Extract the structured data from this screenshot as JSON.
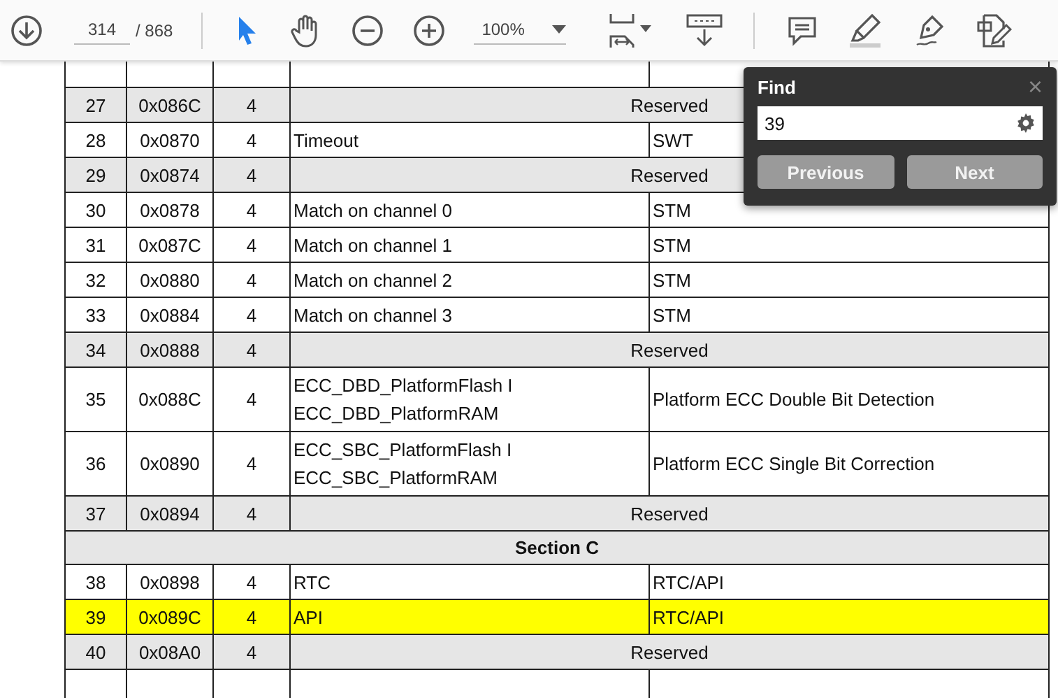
{
  "toolbar": {
    "page_number": "314",
    "page_total": "/ 868",
    "zoom": "100%",
    "tools": [
      {
        "kind": "select",
        "selected": true
      },
      {
        "kind": "hand",
        "selected": false
      }
    ]
  },
  "table": {
    "rows": [
      {
        "kind": "reserved",
        "number": "27",
        "offset": "0x086C",
        "size": "4",
        "source": "Reserved"
      },
      {
        "kind": "entry",
        "number": "28",
        "offset": "0x0870",
        "size": "4",
        "source": [
          "Timeout"
        ],
        "module": "SWT",
        "highlighted": false
      },
      {
        "kind": "reserved",
        "number": "29",
        "offset": "0x0874",
        "size": "4",
        "source": "Reserved"
      },
      {
        "kind": "entry",
        "number": "30",
        "offset": "0x0878",
        "size": "4",
        "source": [
          "Match on channel 0"
        ],
        "module": "STM",
        "highlighted": false
      },
      {
        "kind": "entry",
        "number": "31",
        "offset": "0x087C",
        "size": "4",
        "source": [
          "Match on channel 1"
        ],
        "module": "STM",
        "highlighted": false
      },
      {
        "kind": "entry",
        "number": "32",
        "offset": "0x0880",
        "size": "4",
        "source": [
          "Match on channel 2"
        ],
        "module": "STM",
        "highlighted": false
      },
      {
        "kind": "entry",
        "number": "33",
        "offset": "0x0884",
        "size": "4",
        "source": [
          "Match on channel 3"
        ],
        "module": "STM",
        "highlighted": false
      },
      {
        "kind": "reserved",
        "number": "34",
        "offset": "0x0888",
        "size": "4",
        "source": "Reserved"
      },
      {
        "kind": "entry",
        "number": "35",
        "offset": "0x088C",
        "size": "4",
        "source": [
          "ECC_DBD_PlatformFlash I",
          "ECC_DBD_PlatformRAM"
        ],
        "module": "Platform ECC Double Bit Detection",
        "highlighted": false
      },
      {
        "kind": "entry",
        "number": "36",
        "offset": "0x0890",
        "size": "4",
        "source": [
          "ECC_SBC_PlatformFlash I",
          "ECC_SBC_PlatformRAM"
        ],
        "module": "Platform ECC Single Bit Correction",
        "highlighted": false
      },
      {
        "kind": "reserved",
        "number": "37",
        "offset": "0x0894",
        "size": "4",
        "source": "Reserved"
      },
      {
        "kind": "section",
        "title": "Section C"
      },
      {
        "kind": "entry",
        "number": "38",
        "offset": "0x0898",
        "size": "4",
        "source": [
          "RTC"
        ],
        "module": "RTC/API",
        "highlighted": false
      },
      {
        "kind": "entry",
        "number": "39",
        "offset": "0x089C",
        "size": "4",
        "source": [
          "API"
        ],
        "module": "RTC/API",
        "highlighted": true
      },
      {
        "kind": "reserved",
        "number": "40",
        "offset": "0x08A0",
        "size": "4",
        "source": "Reserved"
      }
    ]
  },
  "find_panel": {
    "title": "Find",
    "close": "×",
    "query": "39",
    "buttons": [
      "Previous",
      "Next"
    ]
  }
}
